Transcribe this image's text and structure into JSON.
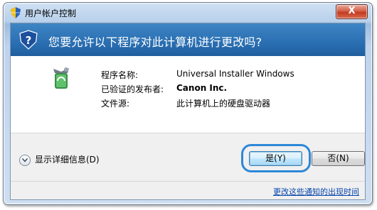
{
  "window": {
    "title": "用户帐户控制",
    "close_label": "X"
  },
  "banner": {
    "question": "您要允许以下程序对此计算机进行更改吗?"
  },
  "program": {
    "name_label": "程序名称:",
    "name_value": "Universal Installer Windows",
    "publisher_label": "已验证的发布者:",
    "publisher_value": "Canon Inc.",
    "origin_label": "文件源:",
    "origin_value": "此计算机上的硬盘驱动器"
  },
  "details": {
    "label": "显示详细信息(D)"
  },
  "buttons": {
    "yes_label": "是(Y)",
    "no_label": "否(N)"
  },
  "footer": {
    "link": "更改这些通知的出现时间"
  },
  "colors": {
    "banner_blue": "#2a6fb2",
    "highlight_ring": "#2d88d8",
    "link": "#0645ad"
  }
}
